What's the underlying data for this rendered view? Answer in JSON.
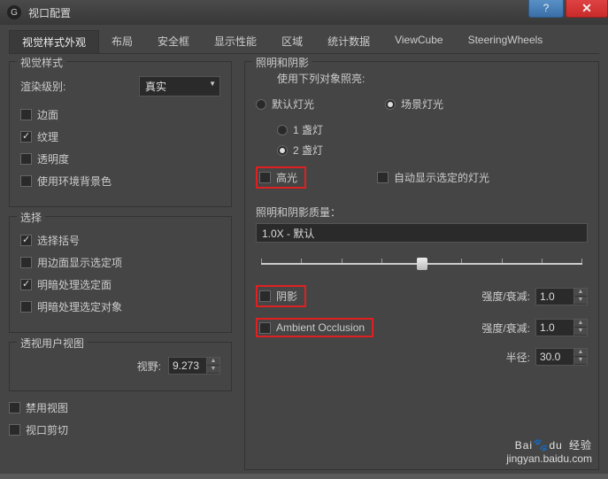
{
  "titlebar": {
    "icon": "G",
    "title": "视口配置"
  },
  "tabs": [
    "视觉样式外观",
    "布局",
    "安全框",
    "显示性能",
    "区域",
    "统计数据",
    "ViewCube",
    "SteeringWheels"
  ],
  "activeTab": 0,
  "left": {
    "group1": {
      "title": "视觉样式",
      "renderLevelLabel": "渲染级别:",
      "renderLevelValue": "真实",
      "edges": "边面",
      "texture": "纹理",
      "transparency": "透明度",
      "envBg": "使用环境背景色"
    },
    "group2": {
      "title": "选择",
      "selectBrackets": "选择括号",
      "edgeSelect": "用边面显示选定项",
      "shadeSelected": "明暗处理选定面",
      "shadeSelectedObj": "明暗处理选定对象"
    },
    "group3": {
      "title": "透视用户视图",
      "fovLabel": "视野:",
      "fovValue": "9.273"
    },
    "disableViewport": "禁用视图",
    "viewportClip": "视口剪切"
  },
  "right": {
    "group": {
      "title": "照明和阴影",
      "useObjLightLabel": "使用下列对象照亮:",
      "defaultLight": "默认灯光",
      "sceneLight": "场景灯光",
      "oneLamp": "1 盏灯",
      "twoLamps": "2 盏灯",
      "highlight": "高光",
      "autoShow": "自动显示选定的灯光",
      "qualityLabel": "照明和阴影质量：",
      "qualityValue": "1.0X - 默认",
      "shadow": "阴影",
      "ao": "Ambient Occlusion",
      "intensityLabel": "强度/衰减:",
      "intensityValue": "1.0",
      "radiusLabel": "半径:",
      "radiusValue": "30.0"
    }
  },
  "watermark": {
    "logo1": "Bai",
    "logo2": "du",
    "logo3": "经验",
    "url": "jingyan.baidu.com"
  }
}
